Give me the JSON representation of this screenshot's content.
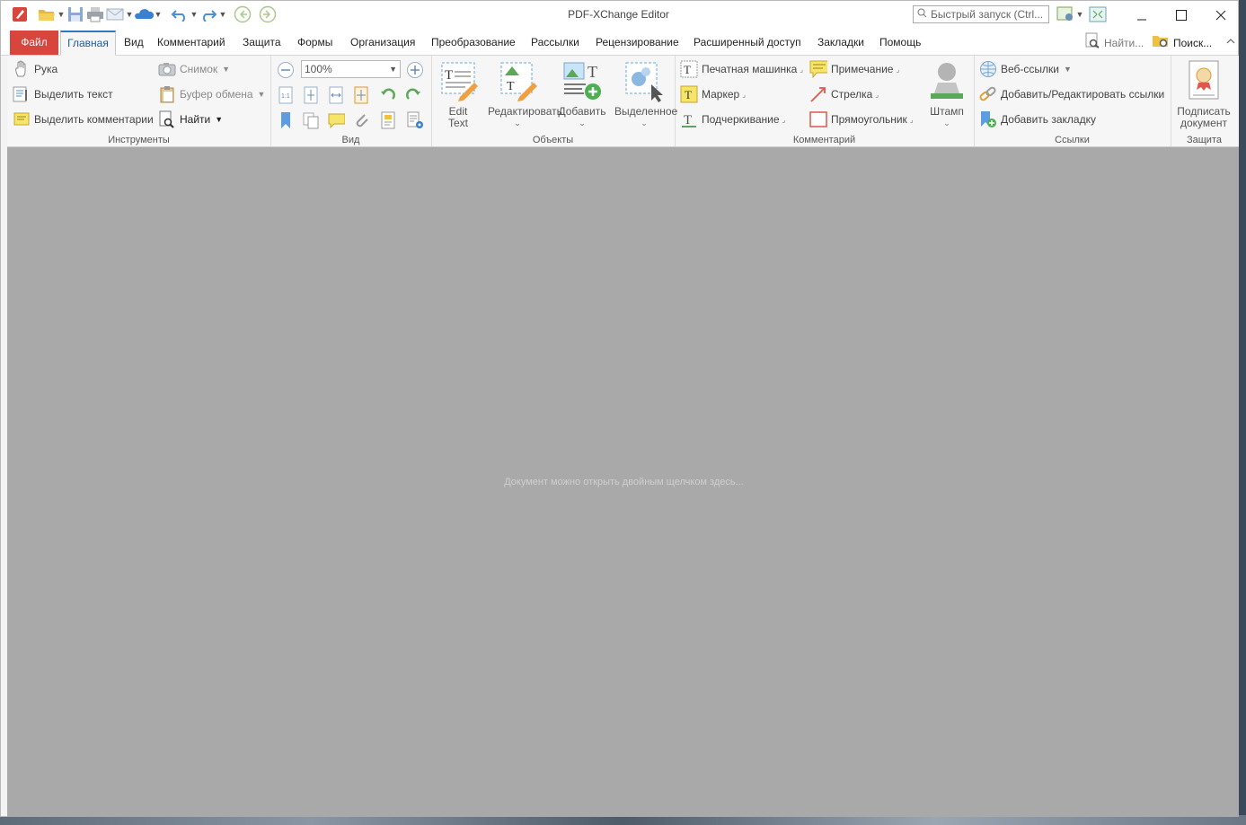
{
  "window": {
    "title": "PDF-XChange Editor",
    "quick_launch_placeholder": "Быстрый запуск (Ctrl...",
    "controls": [
      "minimize-icon",
      "maximize-icon",
      "close-icon"
    ]
  },
  "tabs": {
    "file": "Файл",
    "items": [
      "Главная",
      "Вид",
      "Комментарий",
      "Защита",
      "Формы",
      "Организация",
      "Преобразование",
      "Рассылки",
      "Рецензирование",
      "Расширенный доступ",
      "Закладки",
      "Помощь"
    ],
    "right": [
      "Найти...",
      "Поиск..."
    ]
  },
  "ribbon": {
    "tools": {
      "label": "Инструменты",
      "items": [
        "Рука",
        "Выделить текст",
        "Выделить комментарии",
        "Снимок",
        "Буфер обмена",
        "Найти"
      ]
    },
    "view": {
      "label": "Вид",
      "zoom": "100%"
    },
    "objects": {
      "label": "Объекты",
      "edit_text": "Edit Text",
      "edit": "Редактировать",
      "add": "Добавить",
      "selected": "Выделенное"
    },
    "comment": {
      "label": "Комментарий",
      "items": [
        "Печатная машинка",
        "Маркер",
        "Подчеркивание",
        "Примечание",
        "Стрелка",
        "Прямоугольник"
      ],
      "stamp": "Штамп"
    },
    "links": {
      "label": "Ссылки",
      "items": [
        "Веб-ссылки",
        "Добавить/Редактировать ссылки",
        "Добавить закладку"
      ]
    },
    "protect": {
      "label": "Защита",
      "sign": "Подписать документ"
    }
  },
  "document": {
    "hint": "Документ можно открыть двойным щелчком здесь..."
  },
  "colors": {
    "file_tab": "#d8453c",
    "active_tab_border": "#2e79c4",
    "doc_background": "#a9a9a9"
  }
}
